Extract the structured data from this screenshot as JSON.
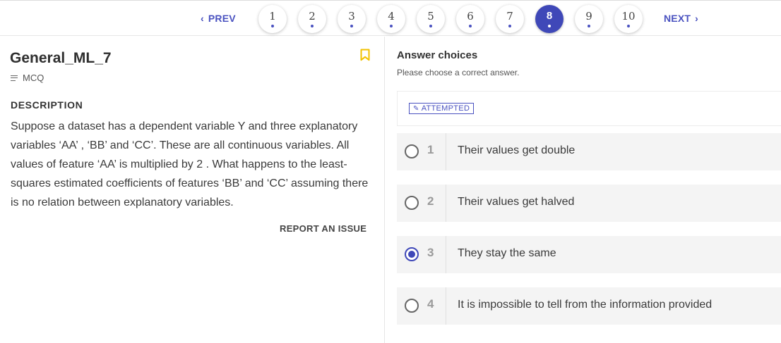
{
  "pagination": {
    "prev_label": "PREV",
    "next_label": "NEXT",
    "pages": [
      "1",
      "2",
      "3",
      "4",
      "5",
      "6",
      "7",
      "8",
      "9",
      "10"
    ],
    "current_page": "8",
    "accent_color": "#3f48b8"
  },
  "question": {
    "title": "General_ML_7",
    "type": "MCQ",
    "description_heading": "DESCRIPTION",
    "description": "Suppose a dataset has a dependent variable Y and three explanatory variables ‘AA’ , ‘BB’ and ‘CC’. These are all continuous variables. All values of feature ‘AA’ is multiplied by 2 . What happens to the least-squares estimated coefficients of features ‘BB’ and ‘CC’ assuming there is no relation between  explanatory variables.",
    "report_label": "REPORT AN ISSUE",
    "bookmark_icon": "bookmark-icon",
    "bookmark_color": "#f2c200"
  },
  "answers": {
    "title": "Answer choices",
    "subtitle": "Please choose a correct answer.",
    "status_badge": "ATTEMPTED",
    "choices": [
      {
        "num": "1",
        "text": "Their values get double",
        "selected": false
      },
      {
        "num": "2",
        "text": "Their values get halved",
        "selected": false
      },
      {
        "num": "3",
        "text": "They stay the same",
        "selected": true
      },
      {
        "num": "4",
        "text": "It is impossible to tell from the information provided",
        "selected": false
      }
    ]
  }
}
